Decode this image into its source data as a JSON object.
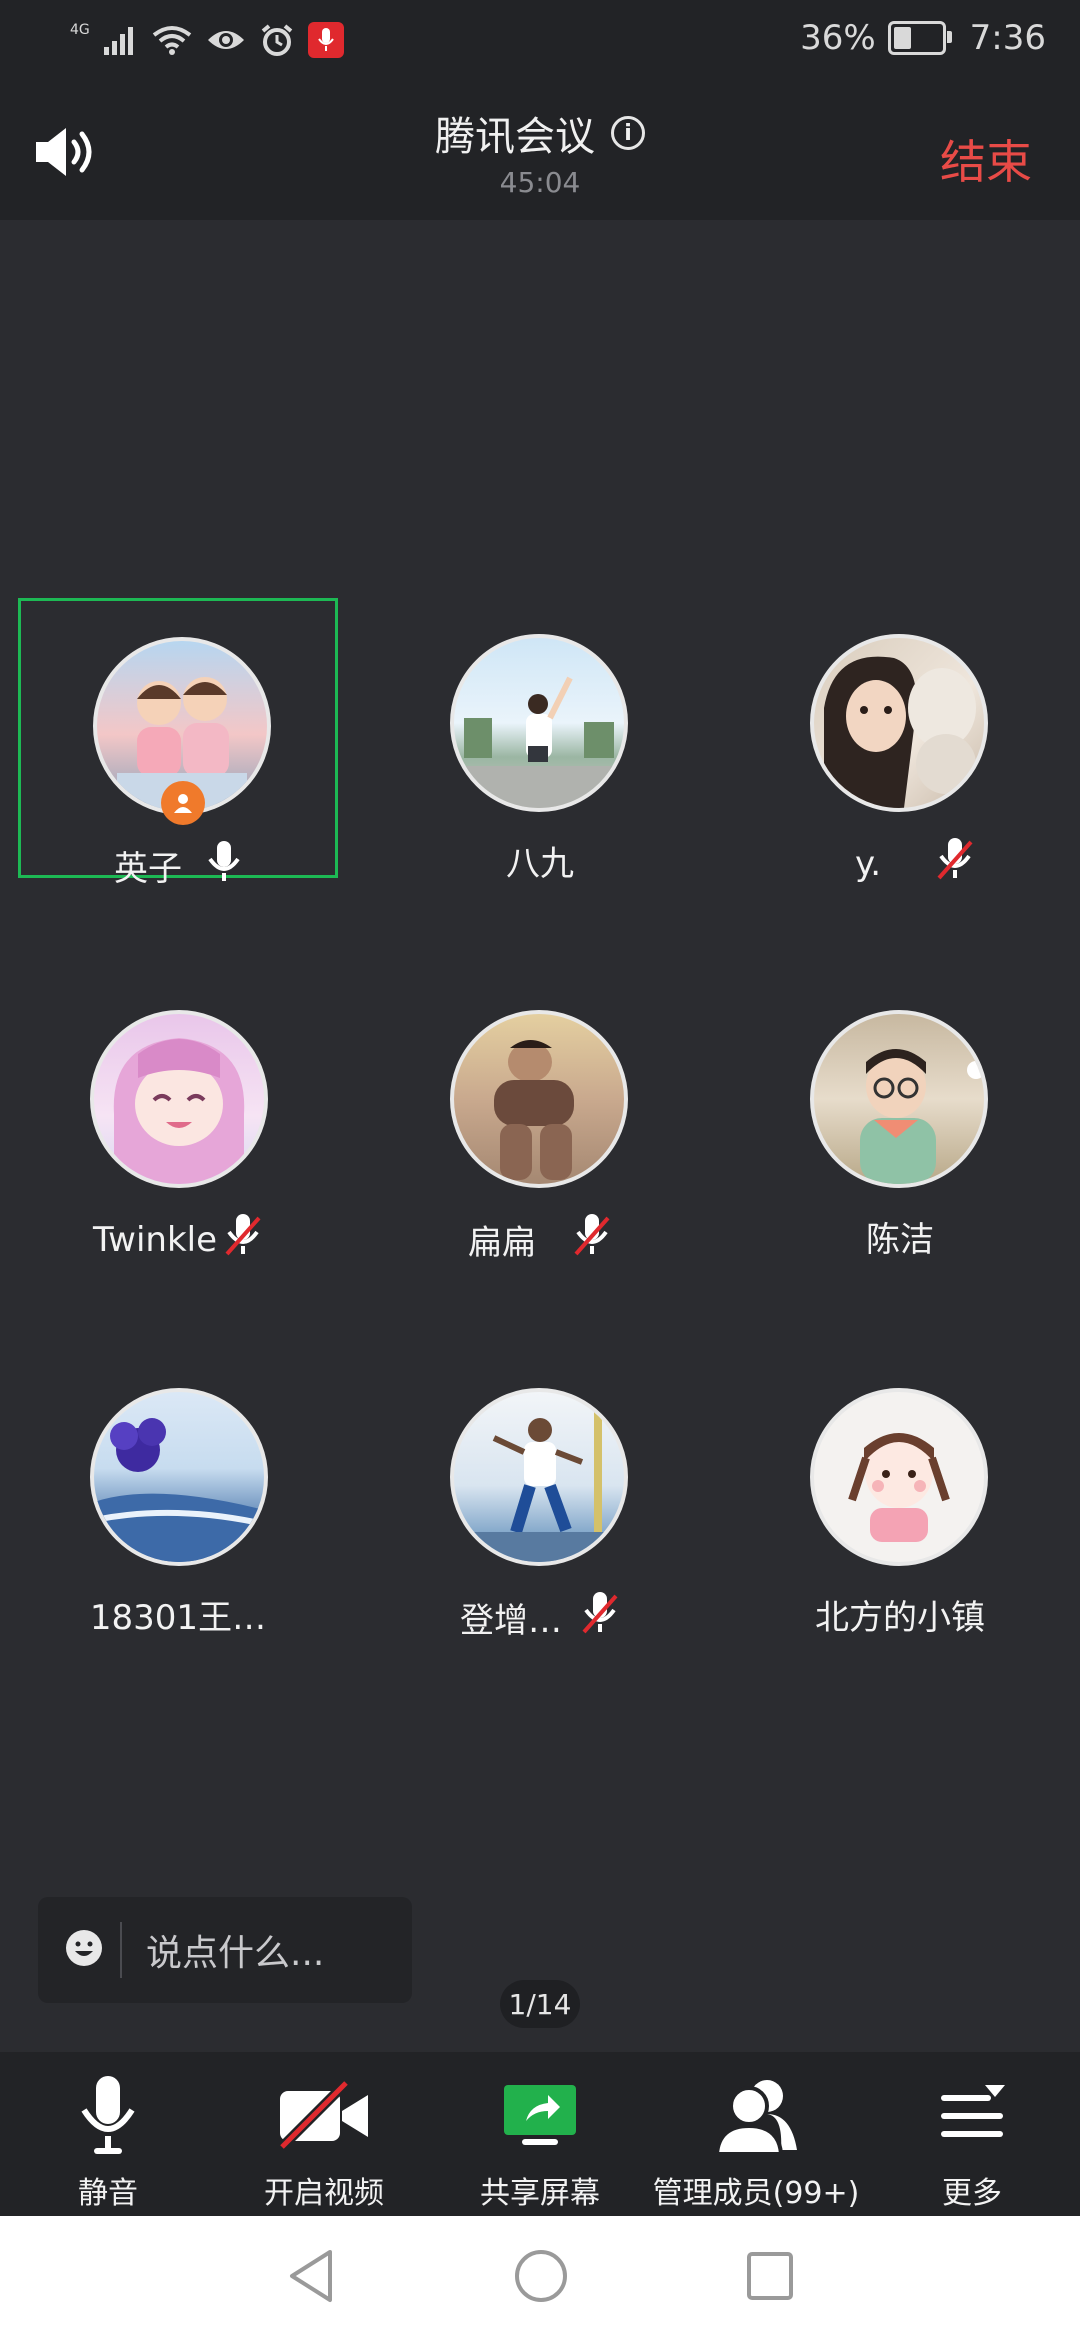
{
  "status_bar": {
    "network": "4G",
    "battery": "36%",
    "battery_level": 0.36,
    "time": "7:36"
  },
  "header": {
    "title": "腾讯会议",
    "duration": "45:04",
    "end_label": "结束"
  },
  "participants": [
    {
      "name": "英子",
      "mic": "on",
      "host": true,
      "active": true
    },
    {
      "name": "八九",
      "mic": "none"
    },
    {
      "name": "y.",
      "mic": "muted"
    },
    {
      "name": "Twinkle",
      "mic": "muted"
    },
    {
      "name": "扁扁",
      "mic": "muted"
    },
    {
      "name": "陈洁",
      "mic": "none"
    },
    {
      "name": "18301王…",
      "mic": "none"
    },
    {
      "name": "登增…",
      "mic": "muted"
    },
    {
      "name": "北方的小镇",
      "mic": "none"
    }
  ],
  "chat": {
    "placeholder": "说点什么..."
  },
  "pagination": {
    "label": "1/14"
  },
  "toolbar": [
    {
      "label": "静音",
      "icon": "microphone-icon"
    },
    {
      "label": "开启视频",
      "icon": "video-off-icon"
    },
    {
      "label": "共享屏幕",
      "icon": "share-screen-icon"
    },
    {
      "label": "管理成员(99+)",
      "icon": "members-icon"
    },
    {
      "label": "更多",
      "icon": "more-menu-icon"
    }
  ],
  "colors": {
    "accent_end": "#e84b47",
    "active_border": "#1db954",
    "host_badge": "#f07a2b",
    "share_green": "#22b14c",
    "video_off_red": "#e0292e"
  }
}
